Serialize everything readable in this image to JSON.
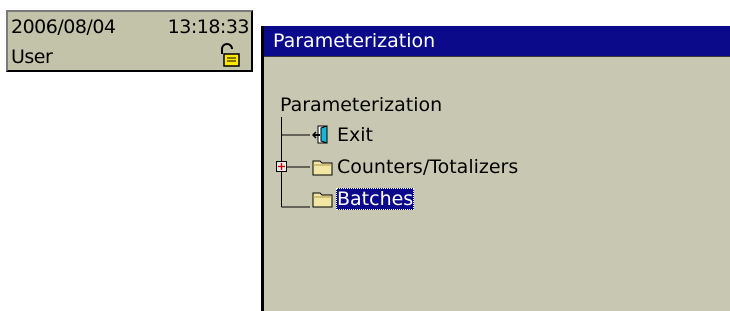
{
  "status": {
    "date": "2006/08/04",
    "time": "13:18:33",
    "user": "User",
    "lock_icon": "unlocked-padlock-icon"
  },
  "window": {
    "title": "Parameterization",
    "tree": {
      "root_label": "Parameterization",
      "items": [
        {
          "label": "Exit",
          "icon": "exit-door-icon",
          "expandable": false,
          "selected": false
        },
        {
          "label": "Counters/Totalizers",
          "icon": "folder-icon",
          "expandable": true,
          "selected": false
        },
        {
          "label": "Batches",
          "icon": "folder-icon",
          "expandable": false,
          "selected": true
        }
      ]
    }
  },
  "colors": {
    "titlebar": "#0a0a8a",
    "window_bg": "#c8c8b2",
    "status_bg": "#c3c3a9",
    "selection": "#0a0a8a"
  }
}
